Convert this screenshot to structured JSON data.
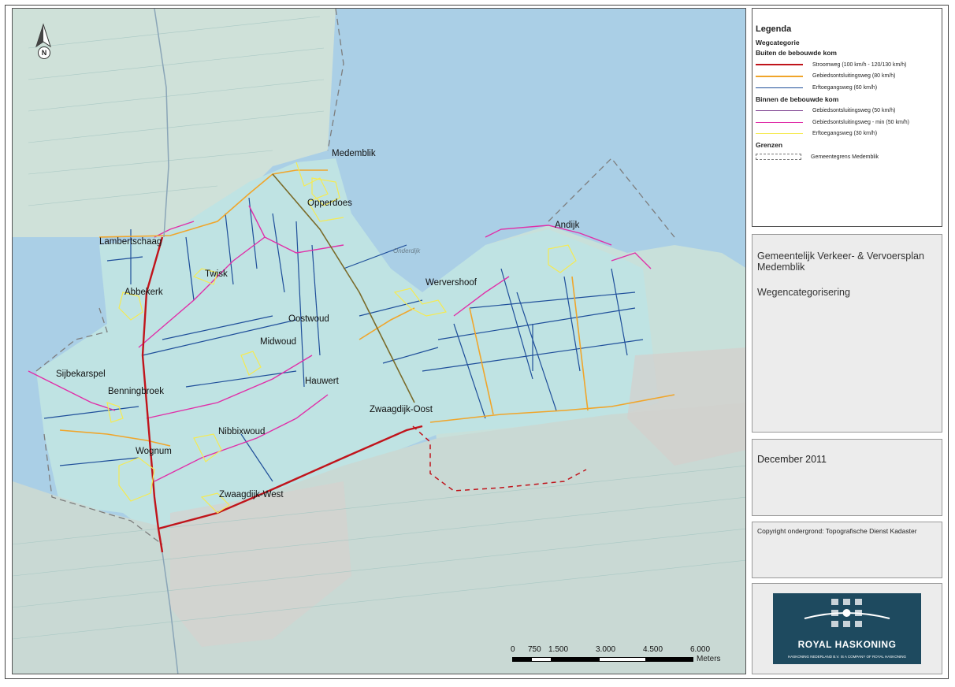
{
  "map": {
    "north_label": "N",
    "water_label": "Onderdijk",
    "places": [
      {
        "id": "medemblik",
        "name": "Medemblik"
      },
      {
        "id": "opperdoes",
        "name": "Opperdoes"
      },
      {
        "id": "lambertschaag",
        "name": "Lambertschaag"
      },
      {
        "id": "twisk",
        "name": "Twisk"
      },
      {
        "id": "abbekerk",
        "name": "Abbekerk"
      },
      {
        "id": "oostwoud",
        "name": "Oostwoud"
      },
      {
        "id": "midwoud",
        "name": "Midwoud"
      },
      {
        "id": "andijk",
        "name": "Andijk"
      },
      {
        "id": "wervershoof",
        "name": "Wervershoof"
      },
      {
        "id": "sijbekarspel",
        "name": "Sijbekarspel"
      },
      {
        "id": "hauwert",
        "name": "Hauwert"
      },
      {
        "id": "benningbroek",
        "name": "Benningbroek"
      },
      {
        "id": "zwaagdijk-oost",
        "name": "Zwaagdijk-Oost"
      },
      {
        "id": "nibbixwoud",
        "name": "Nibbixwoud"
      },
      {
        "id": "wognum",
        "name": "Wognum"
      },
      {
        "id": "zwaagdijk-west",
        "name": "Zwaagdijk-West"
      }
    ],
    "scale": {
      "labels": [
        "0",
        "750",
        "1.500",
        "3.000",
        "4.500",
        "6.000"
      ],
      "unit": "Meters"
    }
  },
  "legend": {
    "title": "Legenda",
    "category_title": "Wegcategorie",
    "outside_title": "Buiten de bebouwde kom",
    "outside_items": [
      {
        "label": "Stroomweg (100 km/h - 120/130 km/h)",
        "color": "#c0141b"
      },
      {
        "label": "Gebiedsontsluitingsweg (80 km/h)",
        "color": "#f0a52a"
      },
      {
        "label": "Erftoegangsweg (60 km/h)",
        "color": "#1f4f9a"
      }
    ],
    "inside_title": "Binnen de bebouwde kom",
    "inside_items": [
      {
        "label": "Gebiedsontsluitingsweg (50 km/h)",
        "color": "#7a3a8c"
      },
      {
        "label": "Gebiedsontsluitingsweg - min (50 km/h)",
        "color": "#e02fa8"
      },
      {
        "label": "Erftoegangsweg (30 km/h)",
        "color": "#f5ea52"
      }
    ],
    "boundaries_title": "Grenzen",
    "boundary_label": "Gemeentegrens Medemblik"
  },
  "title_panel": {
    "line1": "Gemeentelijk Verkeer- & Vervoersplan",
    "line2": "Medemblik",
    "subtitle": "Wegencategorisering"
  },
  "date": "December 2011",
  "copyright": "Copyright ondergrond: Topografische Dienst Kadaster",
  "logo": {
    "brand": "ROYAL HASKONING",
    "tagline": "HASKONING NEDERLAND B.V. IS A COMPANY OF ROYAL HASKONING"
  }
}
